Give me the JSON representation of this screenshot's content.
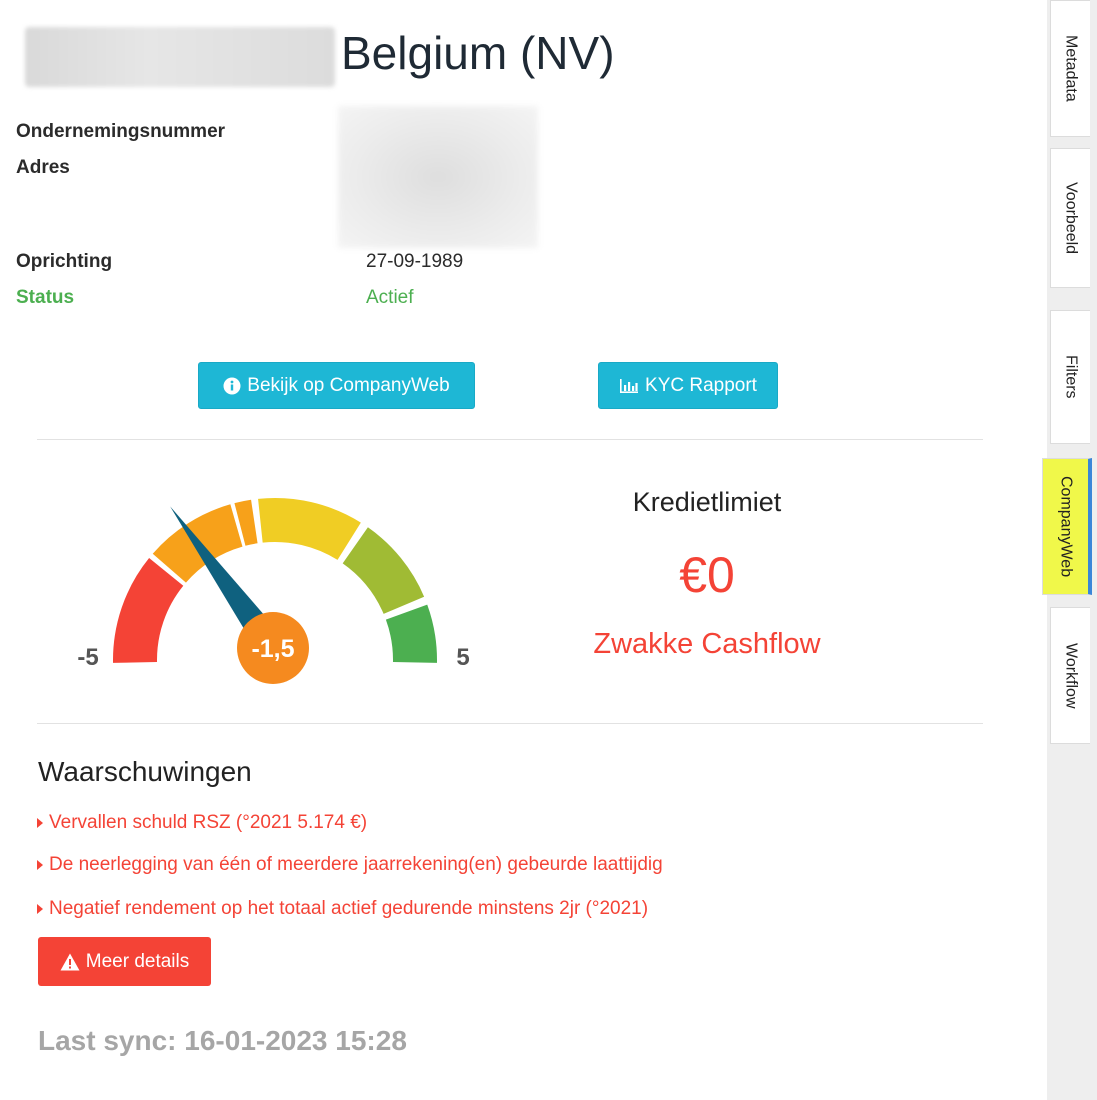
{
  "header": {
    "title": "Belgium (NV)"
  },
  "info": {
    "labels": {
      "ondernemingsnummer": "Ondernemingsnummer",
      "adres": "Adres",
      "oprichting": "Oprichting",
      "status": "Status"
    },
    "oprichting_value": "27-09-1989",
    "status_value": "Actief"
  },
  "buttons": {
    "companyweb": "Bekijk op CompanyWeb",
    "kyc": "KYC Rapport"
  },
  "gauge": {
    "min_label": "-5",
    "max_label": "5",
    "value_label": "-1,5",
    "value": -1.5,
    "min": -5,
    "max": 5,
    "colors": [
      "#f44336",
      "#f7a11a",
      "#f0cd24",
      "#a0bb34",
      "#4caf50"
    ],
    "needle_color": "#0f617f",
    "hub_color": "#f58a1f"
  },
  "credit": {
    "title": "Kredietlimiet",
    "value": "€0",
    "subtitle": "Zwakke Cashflow"
  },
  "warnings": {
    "title": "Waarschuwingen",
    "items": [
      "Vervallen schuld RSZ (°2021 5.174 €)",
      "De neerlegging van één of meerdere jaarrekening(en) gebeurde laattijdig",
      "Negatief rendement op het totaal actief gedurende minstens 2jr (°2021)"
    ],
    "details_button": "Meer details"
  },
  "sync": "Last sync: 16-01-2023 15:28",
  "side_tabs": [
    {
      "label": "Metadata",
      "active": false
    },
    {
      "label": "Voorbeeld",
      "active": false
    },
    {
      "label": "Filters",
      "active": false
    },
    {
      "label": "CompanyWeb",
      "active": true
    },
    {
      "label": "Workflow",
      "active": false
    }
  ],
  "colors": {
    "accent": "#1eb7d5",
    "danger": "#f44336",
    "success": "#4caf50",
    "active_tab": "#f0f84a"
  }
}
